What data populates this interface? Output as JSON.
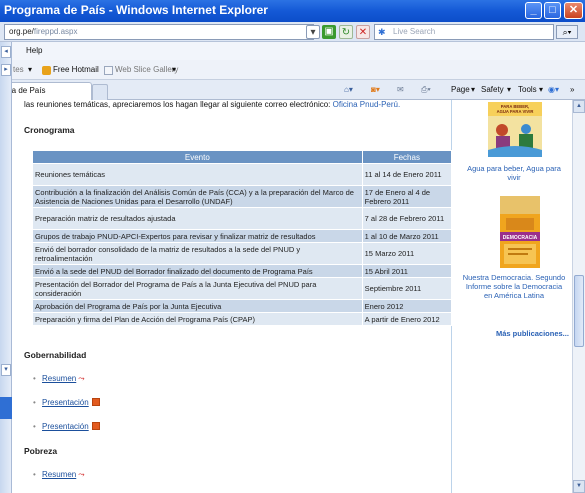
{
  "window": {
    "title": "Programa de País - Windows Internet Explorer",
    "minimize_glyph": "_",
    "maximize_glyph": "□",
    "close_glyph": "✕"
  },
  "address": {
    "url_prefix": "org.pe/",
    "url_path": "fireppd.aspx",
    "search_placeholder": "Live Search"
  },
  "menu": {
    "help": "Help"
  },
  "favorites": {
    "partial_left": "tes",
    "free_hotmail": "Free Hotmail",
    "web_slice": "Web Slice Gallery"
  },
  "tab": {
    "label": "ma de País"
  },
  "commands": {
    "page": "Page",
    "safety": "Safety",
    "tools": "Tools"
  },
  "content": {
    "top_text": "las reuniones temáticas, apreciaremos los hagan llegar al siguiente correo electrónico:",
    "top_link": "Oficina Pnud-Perú.",
    "cronograma_title": "Cronograma",
    "table": {
      "headers": [
        "Evento",
        "Fechas"
      ],
      "rows": [
        [
          "Reuniones temáticas",
          "11 al 14 de Enero 2011"
        ],
        [
          "Contribución a la finalización del Análisis Común de País (CCA) y a la preparación del Marco de Asistencia de Naciones Unidas para el Desarrollo (UNDAF)",
          "17 de Enero al 4 de Febrero 2011"
        ],
        [
          "Preparación matriz de resultados ajustada",
          "7 al 28 de Febrero 2011"
        ],
        [
          "Grupos de trabajo PNUD-APCI-Expertos para revisar y finalizar matriz de resultados",
          "1 al 10 de Marzo 2011"
        ],
        [
          "Envió del borrador consolidado de la matriz de resultados a la sede del PNUD y retroalimentación",
          "15 Marzo 2011"
        ],
        [
          "Envió a la sede del PNUD del Borrador finalizado del documento de Programa País",
          "15 Abril 2011"
        ],
        [
          "Presentación del Borrador del Programa de País a la Junta Ejecutiva del PNUD para consideración",
          "Septiembre 2011"
        ],
        [
          "Aprobación del Programa de País por la Junta Ejecutiva",
          "Enero 2012"
        ],
        [
          "Preparación y firma del Plan de Acción del Programa País (CPAP)",
          "A partir de Enero 2012"
        ]
      ]
    },
    "gobernabilidad_title": "Gobernabilidad",
    "pobreza_title": "Pobreza",
    "links": {
      "resumen": "Resumen",
      "presentacion": "Presentación"
    }
  },
  "sidebar": {
    "poster1_title": "PARA BEBER, AGUA PARA VIVIR",
    "caption1": "Agua para beber, Agua para vivir",
    "poster2_title": "DEMOCRACIA",
    "caption2": "Nuestra Democracia. Segundo Informe sobre la Democracia en América Latina",
    "more": "Más publicaciones..."
  },
  "colors": {
    "table_header": "#6a93c3",
    "row_light": "#dfe8f2",
    "row_dark": "#c9d7e8",
    "link": "#2b62b5",
    "titlebar": "#1459d6"
  }
}
